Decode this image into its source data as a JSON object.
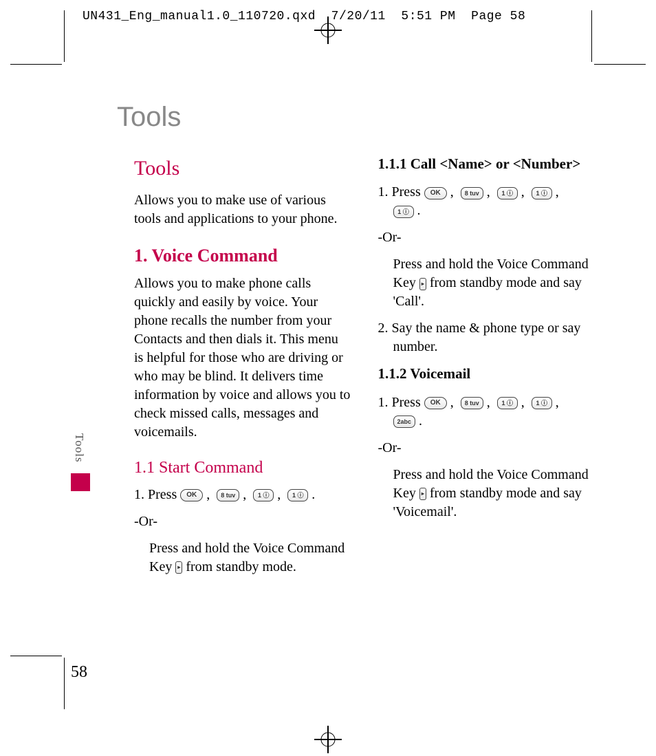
{
  "header": {
    "filename": "UN431_Eng_manual1.0_110720.qxd",
    "date": "7/20/11",
    "time": "5:51 PM",
    "action": "Page 58"
  },
  "page": {
    "running_title": "Tools",
    "side_label": "Tools",
    "number": "58"
  },
  "keys": {
    "ok": "OK",
    "k8": "8 tuv",
    "k1": "1 ⓘ",
    "k2": "2abc",
    "vc": "▸"
  },
  "left": {
    "h1": "Tools",
    "intro": "Allows you to make use of various tools and applications to your phone.",
    "h2": "1. Voice Command",
    "vc_intro": "Allows you to make phone calls quickly and easily by voice. Your phone recalls the number from your Contacts and then dials it. This menu is helpful for those who are driving or who may be blind. It delivers time information by voice and allows you to check missed calls, messages and voicemails.",
    "h3": "1.1 Start Command",
    "step1_a": "1. Press ",
    "or": "-Or-",
    "sub_a": "Press and hold the Voice Command Key ",
    "sub_b": " from standby mode."
  },
  "right": {
    "h111": "1.1.1 Call <Name> or <Number>",
    "step1_a": "1. Press ",
    "or1": "-Or-",
    "sub1_a": "Press and hold the Voice Command Key ",
    "sub1_b": " from standby mode and say 'Call'.",
    "step2": "2. Say the name & phone type or say number.",
    "h112": "1.1.2 Voicemail",
    "step1b_a": "1. Press ",
    "or2": "-Or-",
    "sub2_a": "Press and hold the Voice Command Key ",
    "sub2_b": " from standby mode and say 'Voicemail'."
  }
}
